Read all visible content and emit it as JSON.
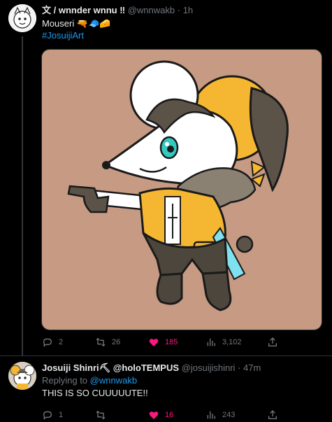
{
  "icons": {
    "reply": "reply-icon",
    "retweet": "retweet-icon",
    "like": "heart-icon",
    "views": "views-icon",
    "share": "share-icon"
  },
  "colors": {
    "background": "#000000",
    "text": "#e7e9ea",
    "muted": "#71767b",
    "link": "#1d9bf0",
    "like_active": "#f91880",
    "media_background": "#c79a83"
  },
  "tweet1": {
    "display_name": "文 / wnnder wnnu ‼",
    "handle": "@wnnwakb",
    "separator": "·",
    "time": "1h",
    "text": "Mouseri 🔫🧢🧀",
    "hashtag": "#JosuijiArt",
    "stats": {
      "replies": "2",
      "retweets": "26",
      "likes": "185",
      "views": "3,102"
    }
  },
  "tweet2": {
    "display_name": "Josuiji Shinri⛏ @holoTEMPUS",
    "handle": "@josuijishinri",
    "separator": "·",
    "time": "47m",
    "reply_to_label": "Replying to",
    "reply_to_handle": "@wnnwakb",
    "text": "THIS IS SO CUUUUUTE!!",
    "stats": {
      "replies": "1",
      "retweets": "",
      "likes": "16",
      "views": "243"
    }
  }
}
